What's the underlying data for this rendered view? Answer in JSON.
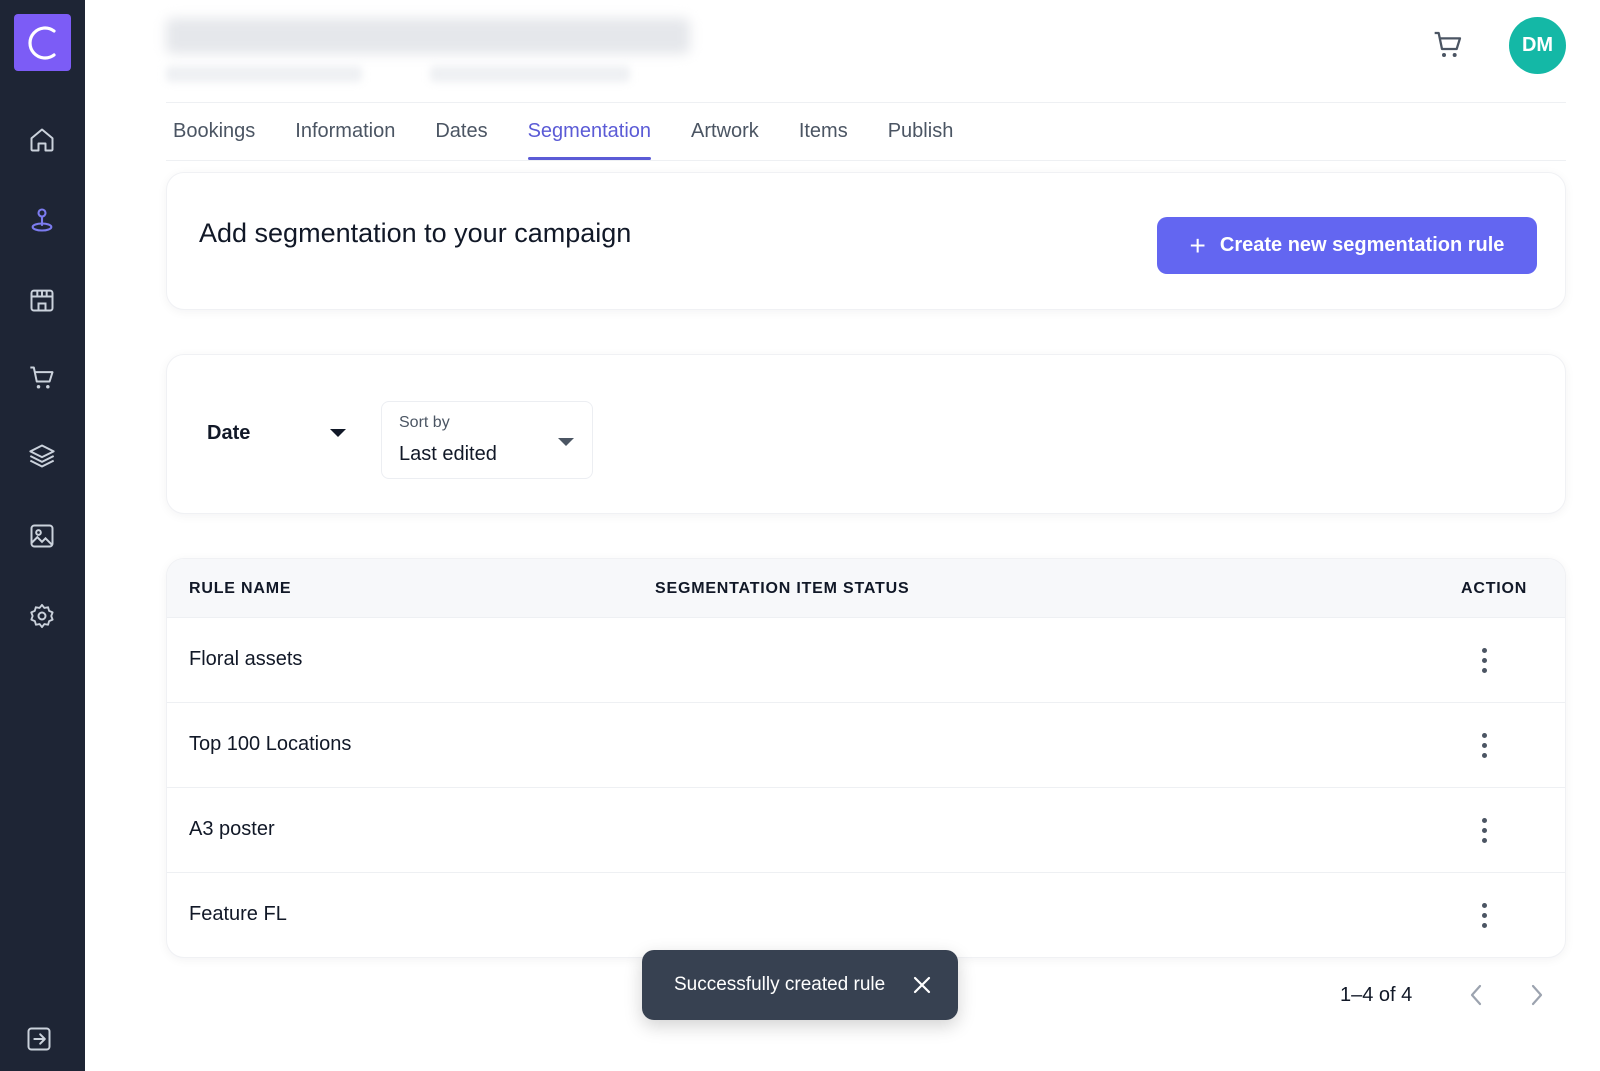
{
  "sidebar": {
    "logo_letter": "C",
    "items": [
      {
        "name": "home-icon",
        "active": false
      },
      {
        "name": "campaign-pin-icon",
        "active": true
      },
      {
        "name": "store-icon",
        "active": false
      },
      {
        "name": "cart-icon",
        "active": false
      },
      {
        "name": "layers-icon",
        "active": false
      },
      {
        "name": "image-icon",
        "active": false
      },
      {
        "name": "settings-icon",
        "active": false
      }
    ],
    "bottom_icon": "logout-icon"
  },
  "header": {
    "avatar_initials": "DM",
    "cart_icon": "cart-icon"
  },
  "tabs": [
    {
      "label": "Bookings",
      "active": false
    },
    {
      "label": "Information",
      "active": false
    },
    {
      "label": "Dates",
      "active": false
    },
    {
      "label": "Segmentation",
      "active": true
    },
    {
      "label": "Artwork",
      "active": false
    },
    {
      "label": "Items",
      "active": false
    },
    {
      "label": "Publish",
      "active": false
    }
  ],
  "segmentation": {
    "heading": "Add segmentation to your campaign",
    "create_button": "Create new segmentation rule"
  },
  "filters": {
    "date_label": "Date",
    "sort_label": "Sort by",
    "sort_value": "Last edited"
  },
  "table": {
    "columns": [
      "RULE NAME",
      "SEGMENTATION ITEM STATUS",
      "ACTION"
    ],
    "rows": [
      {
        "name": "Floral assets"
      },
      {
        "name": "Top 100 Locations"
      },
      {
        "name": "A3 poster"
      },
      {
        "name": "Feature FL"
      }
    ]
  },
  "toast": {
    "message": "Successfully created rule"
  },
  "pagination": {
    "range": "1–4 of 4"
  },
  "colors": {
    "sidebar_bg": "#1e2535",
    "logo_bg": "#7c5cf6",
    "accent": "#6366f1",
    "avatar_bg": "#14b8a6",
    "toast_bg": "#374151"
  }
}
